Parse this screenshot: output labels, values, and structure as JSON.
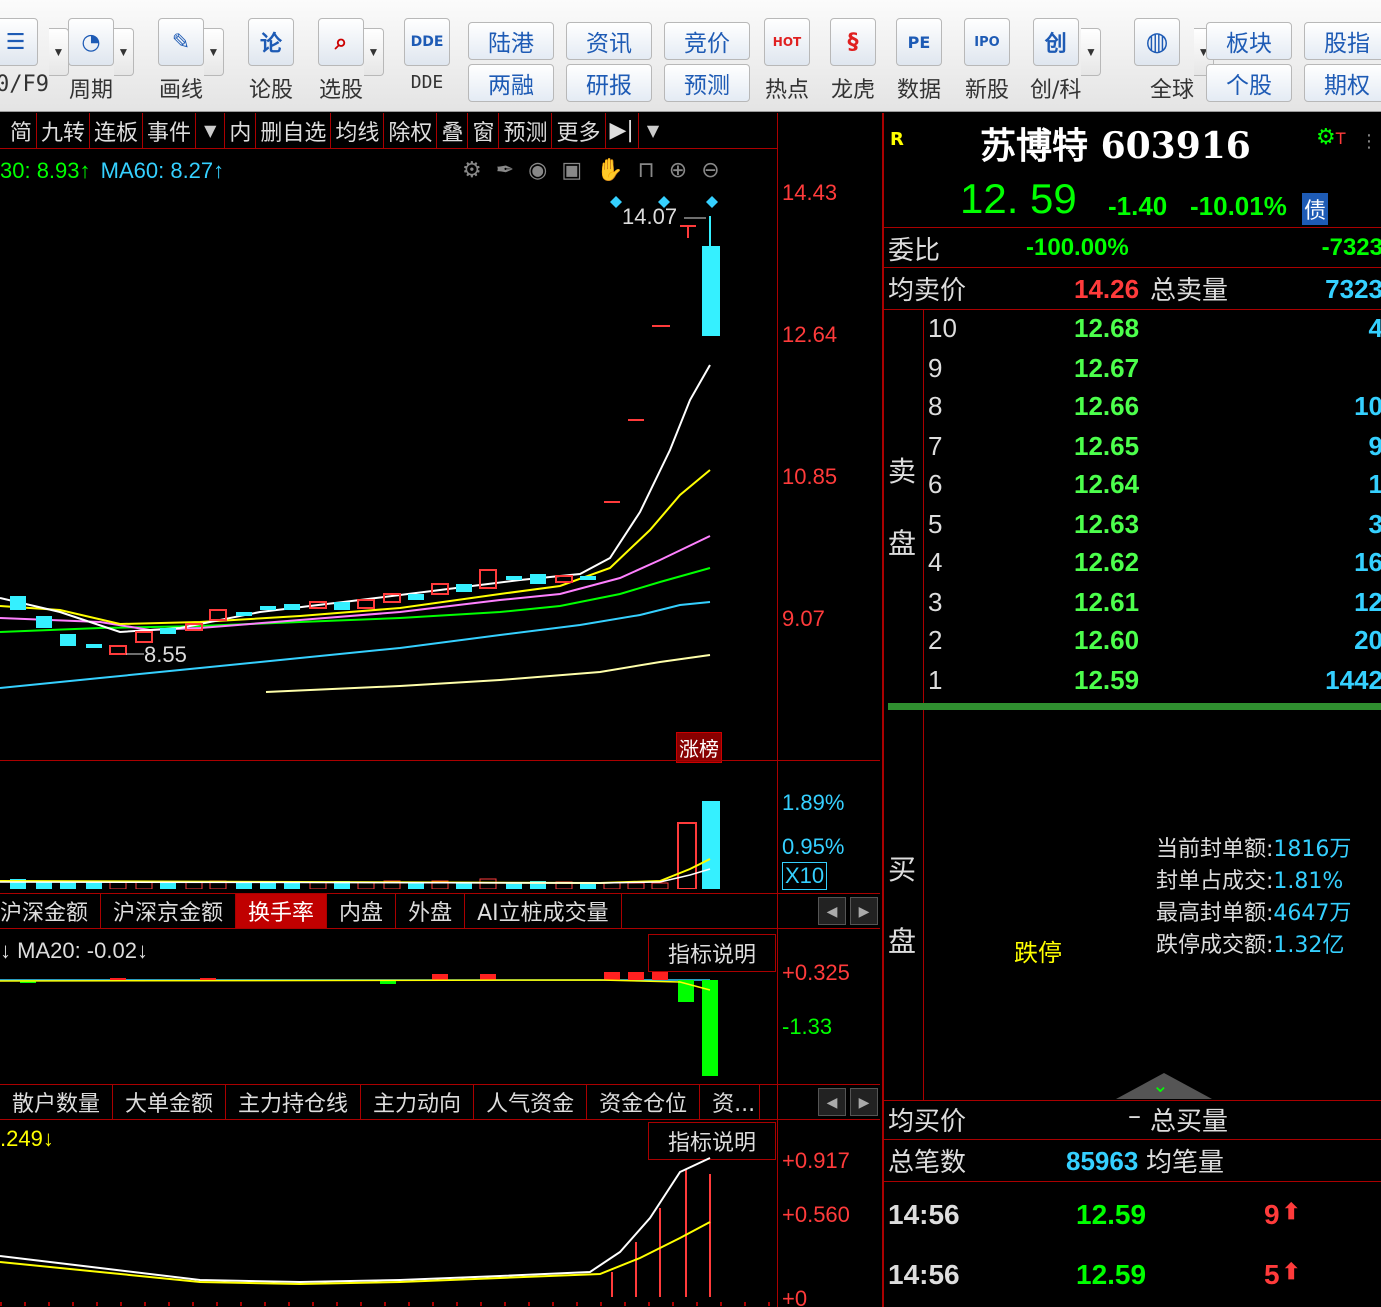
{
  "toolbar": {
    "f9_label": "0/F9",
    "period": "周期",
    "draw_line": "画线",
    "discuss": "论股",
    "stock_pick": "选股",
    "dde": "DDE",
    "lugang": "陆港",
    "liangrong": "两融",
    "zixun": "资讯",
    "yanbao": "研报",
    "jingjia": "竞价",
    "yuce": "预测",
    "redian": "热点",
    "longhu": "龙虎",
    "shuju": "数据",
    "xingu": "新股",
    "chuangke": "创/科",
    "quanqiu": "全球",
    "bankuai": "板块",
    "gegu": "个股",
    "guzhi": "股指",
    "qiquan": "期权",
    "icon_discuss": "论",
    "icon_chuang": "创",
    "icon_dde": "DDE",
    "icon_pe": "PE",
    "icon_ipo": "IPO",
    "icon_hot": "HOT"
  },
  "chart_tabs": [
    "简",
    "九转",
    "连板",
    "事件",
    "内",
    "删自选",
    "均线",
    "除权",
    "叠",
    "窗",
    "预测",
    "更多"
  ],
  "ma_legend": {
    "ma30": "30: 8.93↑",
    "ma60": "MA60: 8.27↑"
  },
  "price_axis": [
    "14.43",
    "12.64",
    "10.85",
    "9.07"
  ],
  "annotations": {
    "high": "14.07",
    "low": "8.55",
    "badge": "涨榜"
  },
  "volume_axis": {
    "top": "1.89%",
    "mid": "0.95%",
    "mult": "X10"
  },
  "indicator_tabs_1": [
    "沪深金额",
    "沪深京金额",
    "换手率",
    "内盘",
    "外盘",
    "AI立桩成交量"
  ],
  "indicator1": {
    "legend": "↓ MA20: -0.02↓",
    "explain": "指标说明",
    "axis_top": "+0.325",
    "axis_mid": "-1.33"
  },
  "indicator_tabs_2": [
    "散户数量",
    "大单金额",
    "主力持仓线",
    "主力动向",
    "人气资金",
    "资金仓位",
    "资..."
  ],
  "indicator2": {
    "legend": ".249↓",
    "explain": "指标说明",
    "axis_top": "+0.917",
    "axis_mid": "+0.560",
    "axis_bot": "+0"
  },
  "quote": {
    "r_badge": "R",
    "name": "苏博特",
    "code": "603916",
    "price": "12. 59",
    "change": "-1.40",
    "change_pct": "-10.01%",
    "bond_badge": "债",
    "weibi_label": "委比",
    "weibi_value": "-100.00%",
    "weicha_value": "-7323",
    "avg_sell_label": "均卖价",
    "avg_sell_value": "14.26",
    "total_sell_label": "总卖量",
    "total_sell_value": "7323",
    "sell_side_label": [
      "卖",
      "盘"
    ],
    "buy_side_label": [
      "买",
      "盘"
    ],
    "asks": [
      {
        "level": "10",
        "price": "12.68",
        "vol": "4"
      },
      {
        "level": "9",
        "price": "12.67",
        "vol": ""
      },
      {
        "level": "8",
        "price": "12.66",
        "vol": "10"
      },
      {
        "level": "7",
        "price": "12.65",
        "vol": "9"
      },
      {
        "level": "6",
        "price": "12.64",
        "vol": "1"
      },
      {
        "level": "5",
        "price": "12.63",
        "vol": "3"
      },
      {
        "level": "4",
        "price": "12.62",
        "vol": "16"
      },
      {
        "level": "3",
        "price": "12.61",
        "vol": "12"
      },
      {
        "level": "2",
        "price": "12.60",
        "vol": "20"
      },
      {
        "level": "1",
        "price": "12.59",
        "vol": "1442"
      }
    ],
    "limit_down": "跌停",
    "seal": [
      {
        "label": "当前封单额:",
        "value": "1816万"
      },
      {
        "label": "封单占成交:",
        "value": "1.81%"
      },
      {
        "label": "最高封单额:",
        "value": "4647万"
      },
      {
        "label": "跌停成交额:",
        "value": "1.32亿"
      }
    ],
    "avg_buy_label": "均买价",
    "avg_buy_value": "–",
    "total_buy_label": "总买量",
    "total_trades_label": "总笔数",
    "total_trades_value": "85963",
    "avg_trade_label": "均笔量",
    "ticks": [
      {
        "time": "14:56",
        "price": "12.59",
        "vol": "9"
      },
      {
        "time": "14:56",
        "price": "12.59",
        "vol": "5"
      }
    ]
  },
  "colors": {
    "up": "#ff3b3b",
    "down": "#35f0ff",
    "bg": "#000000",
    "grid": "#aa0000",
    "ma5": "#ffffff",
    "ma10": "#ffff00",
    "ma20": "#ff80ff",
    "ma30": "#00ff00",
    "ma60": "#35d0ff"
  }
}
